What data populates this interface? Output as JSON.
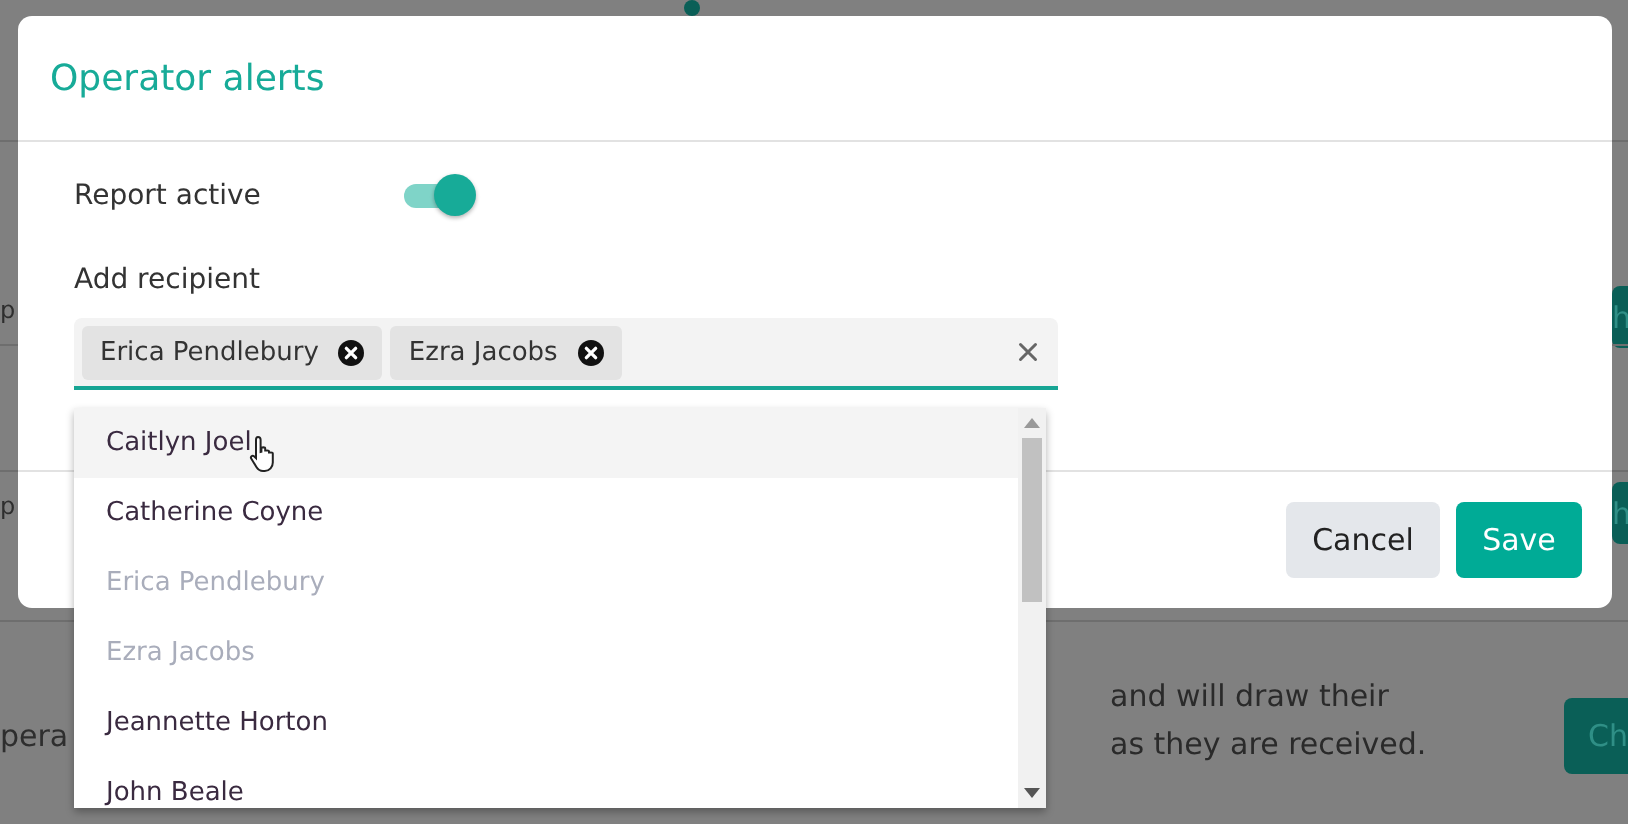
{
  "background": {
    "left_fragments": [
      "p",
      "p",
      "pera"
    ],
    "description": [
      "and will draw their",
      "as they are received."
    ],
    "side_buttons": [
      "h",
      "h",
      "Ch"
    ]
  },
  "dialog": {
    "title": "Operator alerts",
    "report_active": {
      "label": "Report active",
      "on": true
    },
    "recipient": {
      "label": "Add recipient",
      "chips": [
        "Erica Pendlebury",
        "Ezra Jacobs"
      ],
      "open": true
    },
    "options": [
      {
        "label": "Caitlyn Joel",
        "disabled": false,
        "selected": true
      },
      {
        "label": "Catherine Coyne",
        "disabled": false,
        "selected": false
      },
      {
        "label": "Erica Pendlebury",
        "disabled": true,
        "selected": false
      },
      {
        "label": "Ezra Jacobs",
        "disabled": true,
        "selected": false
      },
      {
        "label": "Jeannette Horton",
        "disabled": false,
        "selected": false
      },
      {
        "label": "John Beale",
        "disabled": false,
        "selected": false
      }
    ],
    "buttons": [
      {
        "label": "Cancel",
        "kind": "secondary"
      },
      {
        "label": "Save",
        "kind": "primary"
      }
    ]
  }
}
